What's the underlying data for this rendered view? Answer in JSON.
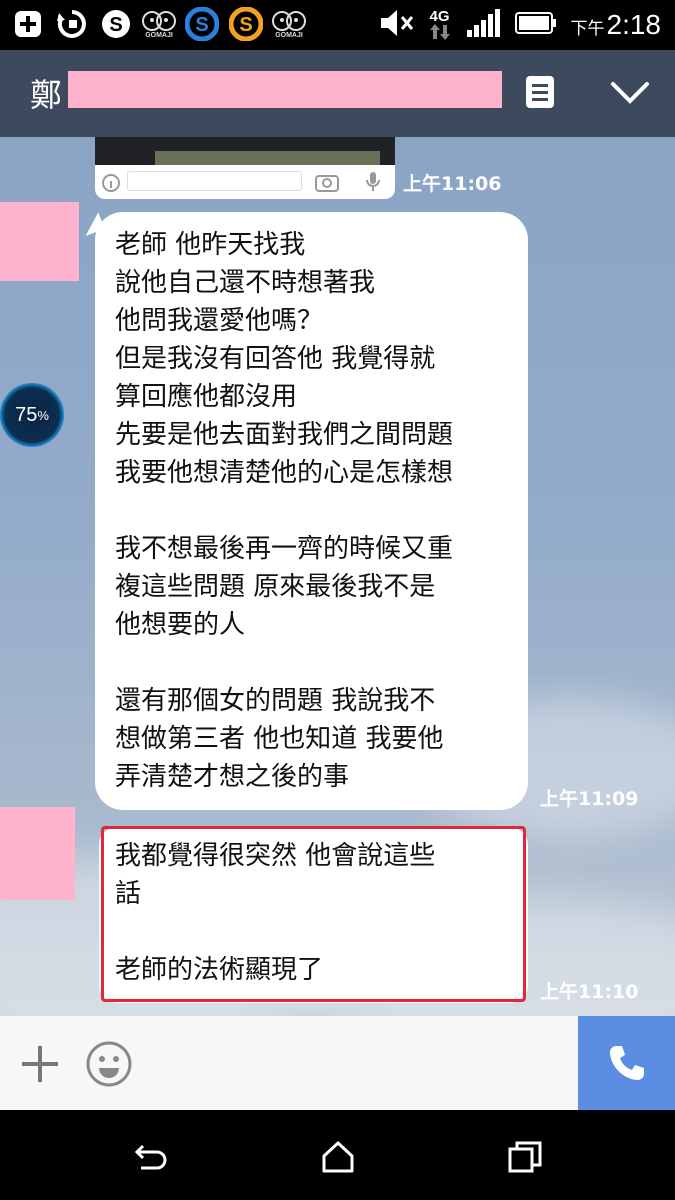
{
  "status_bar": {
    "time_prefix": "下午",
    "time": "2:18",
    "network": "4G",
    "icons": [
      "add-icon",
      "sync-icon",
      "skype-icon",
      "gomaji-icon",
      "s-app-icon",
      "s-app-orange-icon",
      "gomaji-icon",
      "mute-icon",
      "signal-icon",
      "battery-icon"
    ],
    "gomaji_label": "GOMAJI"
  },
  "header": {
    "title_char": "鄭"
  },
  "messages": [
    {
      "type": "image",
      "time": "上午11:06"
    },
    {
      "type": "text",
      "time": "上午11:09",
      "lines": [
        "老師 他昨天找我",
        "說他自己還不時想著我",
        "他問我還愛他嗎？",
        "但是我沒有回答他 我覺得就",
        "算回應他都沒用",
        "先要是他去面對我們之間問題",
        "我要他想清楚他的心是怎樣想",
        "",
        "我不想最後再一齊的時候又重",
        "複這些問題 原來最後我不是",
        "他想要的人",
        "",
        "還有那個女的問題 我說我不",
        "想做第三者 他也知道 我要他",
        "弄清楚才想之後的事"
      ]
    },
    {
      "type": "text",
      "time": "上午11:10",
      "highlighted": true,
      "lines": [
        "我都覺得很突然 他會說這些",
        "話",
        "",
        "老師的法術顯現了"
      ]
    }
  ],
  "battery_overlay": {
    "value": "75",
    "unit": "%"
  },
  "colors": {
    "header_bg": "#3d4a5e",
    "redaction_pink": "#ffb3cc",
    "call_button": "#5b8de3",
    "highlight_border": "#e0283a"
  }
}
